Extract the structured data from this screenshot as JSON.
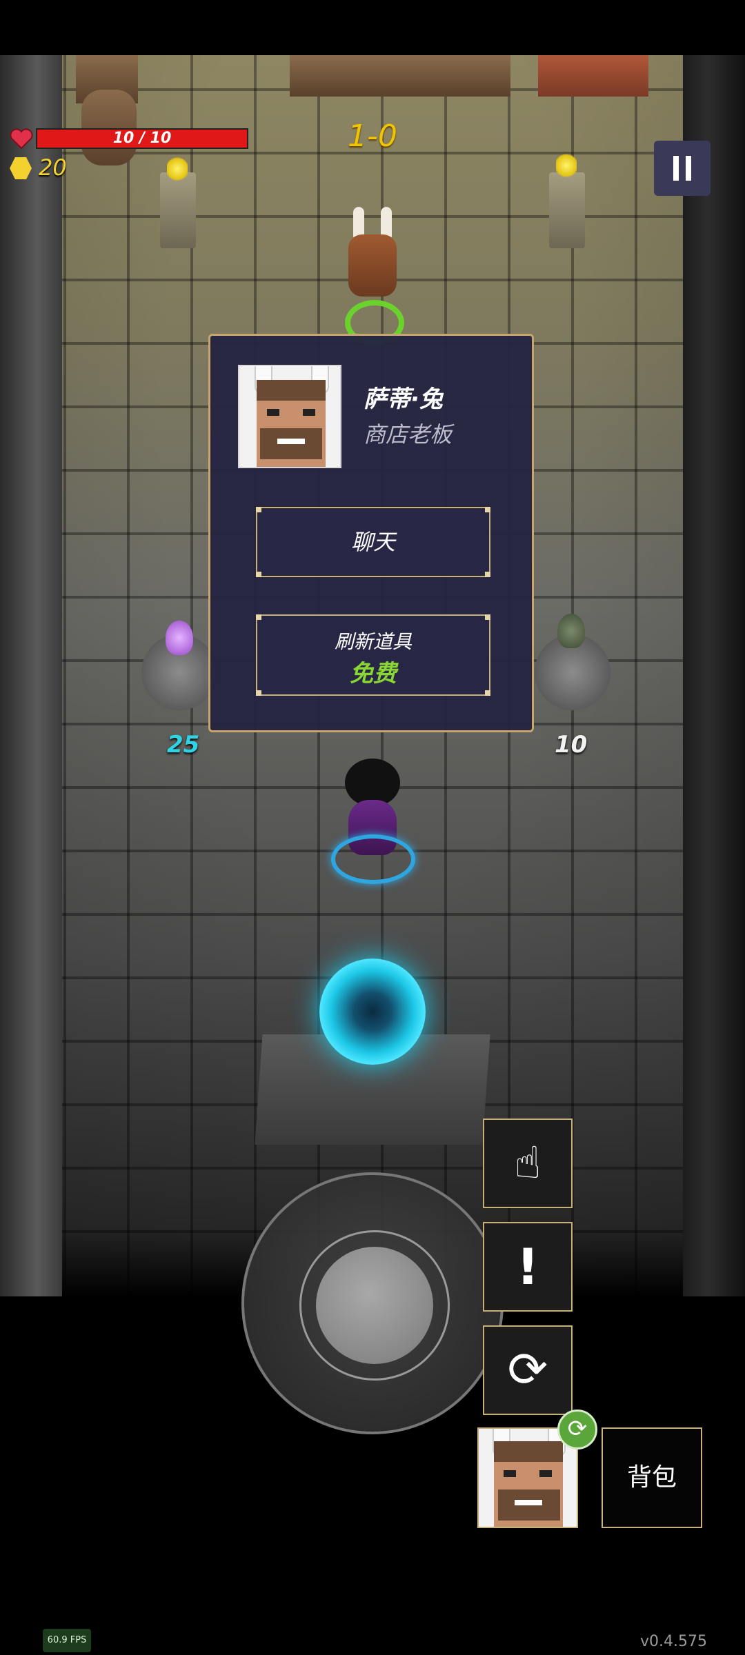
{
  "hud": {
    "hp_text": "10 / 10",
    "hp_fraction": 1.0,
    "gold": "20",
    "level": "1-0",
    "pause_icon": "pause-icon"
  },
  "shop_items": {
    "left_price": "25",
    "right_price": "10"
  },
  "dialog": {
    "npc_name": "萨蒂·兔",
    "npc_role": "商店老板",
    "chat_label": "聊天",
    "refresh_label": "刷新道具",
    "refresh_cost": "免费"
  },
  "controls": {
    "interact_icon": "hand-pointer-icon",
    "alert_label": "!",
    "swap_icon": "refresh-arrows-icon",
    "bag_label": "背包"
  },
  "footer": {
    "fps": "60.9 FPS",
    "version": "v0.4.575"
  },
  "colors": {
    "hp": "#e01818",
    "gold": "#f3d230",
    "level": "#f0c400",
    "free": "#8ad634",
    "panel_border": "#c8a56a",
    "left_price": "#2ed3e6",
    "right_price": "#f2f2f2"
  }
}
